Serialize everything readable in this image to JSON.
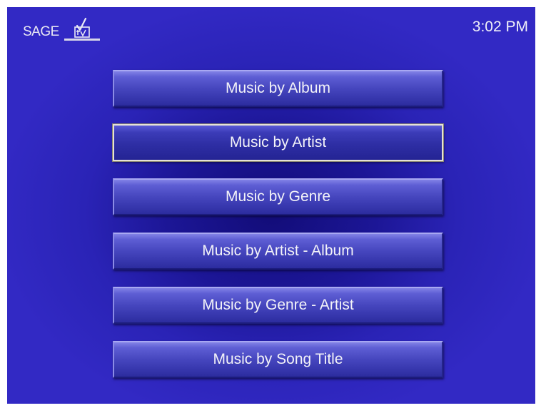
{
  "header": {
    "logo_text": "SAGE",
    "logo_icon": "tv-checkmark-icon",
    "clock": "3:02 PM"
  },
  "menu": {
    "selected_index": 1,
    "items": [
      {
        "label": "Music by Album"
      },
      {
        "label": "Music by Artist"
      },
      {
        "label": "Music by Genre"
      },
      {
        "label": "Music by Artist - Album"
      },
      {
        "label": "Music by Genre - Artist"
      },
      {
        "label": "Music by Song Title"
      }
    ]
  },
  "colors": {
    "background": "#1c1696",
    "button": "#4646be",
    "selected_border": "#e6e2d6",
    "text": "#f3f3f8"
  }
}
